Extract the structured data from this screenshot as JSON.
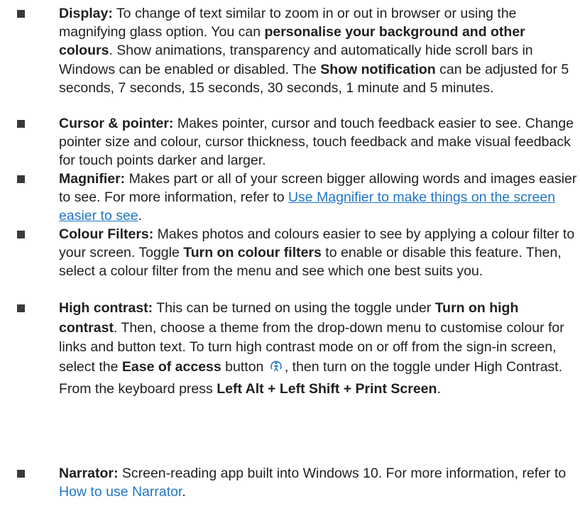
{
  "items": [
    {
      "label": "Display:",
      "parts": [
        " To change of text similar to zoom in or out in browser or using the magnifying glass option. You can ",
        "personalise your background and other colours",
        ". Show animations, transparency and automatically hide scroll bars in Windows can be enabled or disabled. The ",
        "Show notification",
        " can be adjusted for 5 seconds, 7 seconds, 15 seconds, 30 seconds, 1 minute and 5 minutes."
      ]
    },
    {
      "label": "Cursor & pointer:",
      "parts": [
        " Makes pointer, cursor and touch feedback easier to see. Change pointer size and colour, cursor thickness, touch feedback and make visual feedback for touch points darker and larger."
      ]
    },
    {
      "label": "Magnifier:",
      "parts": [
        " Makes part or all of your screen bigger allowing words and images easier to see. For more information, refer to ",
        "Use Magnifier to make things on the screen easier to see",
        "."
      ]
    },
    {
      "label": "Colour Filters:",
      "parts": [
        " Makes photos and colours easier to see by applying a colour filter to your screen. Toggle ",
        "Turn on colour filters",
        " to enable or disable this feature. Then, select a colour filter from the menu and see which one best suits you."
      ]
    },
    {
      "label": "High contrast:",
      "parts": [
        " This can be turned on using the toggle under ",
        "Turn on high contrast",
        ". Then, choose a theme from the drop-down menu to customise colour for links and button text. To turn high contrast mode on or off from the sign-in screen, select the ",
        "Ease of access",
        " button",
        ", then turn on the toggle under High Contrast. From the keyboard press ",
        "Left Alt + Left Shift + Print Screen",
        "."
      ],
      "icon": "ease-of-access-icon"
    },
    {
      "label": "Narrator:",
      "parts": [
        " Screen-reading app built into Windows 10. For more information, refer to ",
        "How to use Narrator",
        "."
      ]
    }
  ],
  "colors": {
    "text": "#1f1f1f",
    "link": "#1f76c6",
    "bullet": "#3a3a3a"
  }
}
